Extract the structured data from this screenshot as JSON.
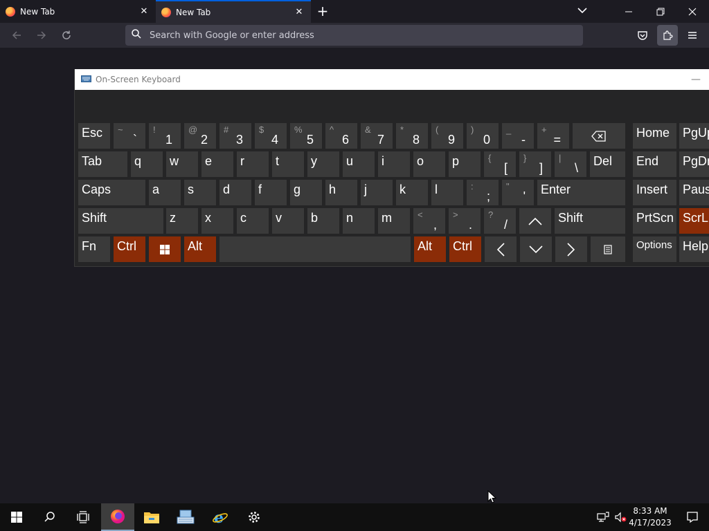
{
  "browser": {
    "tabs": [
      {
        "title": "New Tab"
      },
      {
        "title": "New Tab"
      }
    ],
    "url_placeholder": "Search with Google or enter address"
  },
  "osk": {
    "title": "On-Screen Keyboard",
    "rows": [
      [
        {
          "id": "esc",
          "label": "Esc"
        },
        {
          "id": "backtick",
          "shift": "~",
          "main": "`"
        },
        {
          "id": "1",
          "shift": "!",
          "main": "1"
        },
        {
          "id": "2",
          "shift": "@",
          "main": "2"
        },
        {
          "id": "3",
          "shift": "#",
          "main": "3"
        },
        {
          "id": "4",
          "shift": "$",
          "main": "4"
        },
        {
          "id": "5",
          "shift": "%",
          "main": "5"
        },
        {
          "id": "6",
          "shift": "^",
          "main": "6"
        },
        {
          "id": "7",
          "shift": "&",
          "main": "7"
        },
        {
          "id": "8",
          "shift": "*",
          "main": "8"
        },
        {
          "id": "9",
          "shift": "(",
          "main": "9"
        },
        {
          "id": "0",
          "shift": ")",
          "main": "0"
        },
        {
          "id": "minus",
          "shift": "_",
          "main": "-"
        },
        {
          "id": "equals",
          "shift": "+",
          "main": "="
        },
        {
          "id": "backspace",
          "icon": "backspace-icon"
        },
        {
          "id": "home",
          "label": "Home"
        },
        {
          "id": "pgup",
          "label": "PgUp"
        }
      ],
      [
        {
          "id": "tab",
          "label": "Tab"
        },
        {
          "id": "q",
          "label": "q"
        },
        {
          "id": "w",
          "label": "w"
        },
        {
          "id": "e",
          "label": "e"
        },
        {
          "id": "r",
          "label": "r"
        },
        {
          "id": "t",
          "label": "t"
        },
        {
          "id": "y",
          "label": "y"
        },
        {
          "id": "u",
          "label": "u"
        },
        {
          "id": "i",
          "label": "i"
        },
        {
          "id": "o",
          "label": "o"
        },
        {
          "id": "p",
          "label": "p"
        },
        {
          "id": "lbracket",
          "shift": "{",
          "main": "["
        },
        {
          "id": "rbracket",
          "shift": "}",
          "main": "]"
        },
        {
          "id": "backslash",
          "shift": "|",
          "main": "\\"
        },
        {
          "id": "del",
          "label": "Del"
        },
        {
          "id": "end",
          "label": "End"
        },
        {
          "id": "pgdn",
          "label": "PgDn"
        }
      ],
      [
        {
          "id": "caps",
          "label": "Caps"
        },
        {
          "id": "a",
          "label": "a"
        },
        {
          "id": "s",
          "label": "s"
        },
        {
          "id": "d",
          "label": "d"
        },
        {
          "id": "f",
          "label": "f"
        },
        {
          "id": "g",
          "label": "g"
        },
        {
          "id": "h",
          "label": "h"
        },
        {
          "id": "j",
          "label": "j"
        },
        {
          "id": "k",
          "label": "k"
        },
        {
          "id": "l",
          "label": "l"
        },
        {
          "id": "semicolon",
          "shift": ":",
          "main": ";"
        },
        {
          "id": "quote",
          "shift": "\"",
          "main": "'"
        },
        {
          "id": "enter",
          "label": "Enter"
        },
        {
          "id": "insert",
          "label": "Insert"
        },
        {
          "id": "pause",
          "label": "Pause"
        }
      ],
      [
        {
          "id": "lshift",
          "label": "Shift"
        },
        {
          "id": "z",
          "label": "z"
        },
        {
          "id": "x",
          "label": "x"
        },
        {
          "id": "c",
          "label": "c"
        },
        {
          "id": "v",
          "label": "v"
        },
        {
          "id": "b",
          "label": "b"
        },
        {
          "id": "n",
          "label": "n"
        },
        {
          "id": "m",
          "label": "m"
        },
        {
          "id": "comma",
          "shift": "<",
          "main": ","
        },
        {
          "id": "period",
          "shift": ">",
          "main": "."
        },
        {
          "id": "slash",
          "shift": "?",
          "main": "/"
        },
        {
          "id": "up",
          "icon": "arrow-up-icon"
        },
        {
          "id": "rshift",
          "label": "Shift"
        },
        {
          "id": "prtscn",
          "label": "PrtScn"
        },
        {
          "id": "scrlk",
          "label": "ScrLk",
          "selected": true
        }
      ],
      [
        {
          "id": "fn",
          "label": "Fn"
        },
        {
          "id": "lctrl",
          "label": "Ctrl",
          "selected": true
        },
        {
          "id": "win",
          "icon": "windows-logo-icon",
          "selected": true
        },
        {
          "id": "lalt",
          "label": "Alt",
          "selected": true
        },
        {
          "id": "space",
          "label": ""
        },
        {
          "id": "ralt",
          "label": "Alt",
          "selected": true
        },
        {
          "id": "rctrl",
          "label": "Ctrl",
          "selected": true
        },
        {
          "id": "left",
          "icon": "arrow-left-icon"
        },
        {
          "id": "down",
          "icon": "arrow-down-icon"
        },
        {
          "id": "right",
          "icon": "arrow-right-icon"
        },
        {
          "id": "menu",
          "icon": "context-menu-icon"
        },
        {
          "id": "options",
          "label": "Options"
        },
        {
          "id": "help",
          "label": "Help"
        }
      ]
    ]
  },
  "taskbar": {
    "apps": [
      "start-icon",
      "search-icon",
      "task-view-icon",
      "firefox-icon",
      "file-explorer-icon",
      "on-screen-keyboard-icon",
      "internet-explorer-icon",
      "settings-gear-icon"
    ],
    "time": "8:33 AM",
    "date": "4/17/2023"
  }
}
